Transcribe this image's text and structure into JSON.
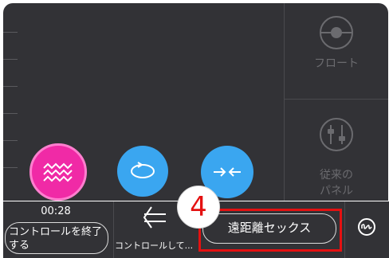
{
  "side_panel": {
    "float_label": "フロート",
    "classic_label_line1": "従来の",
    "classic_label_line2": "パネル"
  },
  "mode_buttons": {
    "wave_icon": "wave-icon",
    "rotate_icon": "rotate-icon",
    "inward_icon": "arrows-inward-icon"
  },
  "bottom_bar": {
    "timer": "00:28",
    "end_control_label": "コントロールを終了する",
    "control_label": "コントロールして...",
    "remote_label": "遠距離セックス",
    "step_number": "4"
  },
  "colors": {
    "panel_bg": "#323236",
    "accent_pink": "#f02aa6",
    "accent_blue": "#3aa6f0",
    "highlight_red": "#e41111"
  }
}
